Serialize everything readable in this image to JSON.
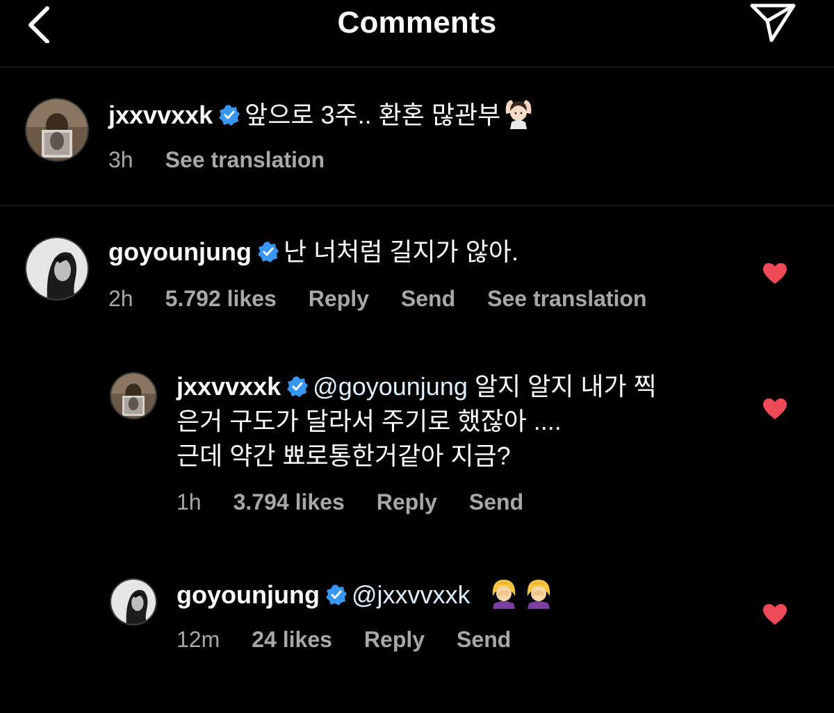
{
  "header": {
    "title": "Comments",
    "back_icon": "chevron-left-icon",
    "send_icon": "paper-plane-icon"
  },
  "colors": {
    "background": "#000000",
    "text": "#ffffff",
    "meta_text": "#a8a8a8",
    "verified": "#3897f0",
    "heart": "#ed4956",
    "mention": "#e0f1ff"
  },
  "caption": {
    "username": "jxxvvxxk",
    "text": "앞으로 3주.. 환혼 많관부",
    "time": "3h",
    "see_translation": "See translation"
  },
  "comments": [
    {
      "username": "goyounjung",
      "text": "난 너처럼 길지가 않아.",
      "time": "2h",
      "likes": "5.792 likes",
      "reply": "Reply",
      "send": "Send",
      "see_translation": "See translation",
      "liked": true
    },
    {
      "username": "jxxvvxxk",
      "mention": "@goyounjung",
      "text_line1": "알지 알지 내가 찍",
      "text_line2": "은거 구도가 달라서 주기로 했잖아 ....",
      "text_line3": "근데 약간 뾰로통한거같아 지금?",
      "time": "1h",
      "likes": "3.794 likes",
      "reply": "Reply",
      "send": "Send",
      "liked": true
    },
    {
      "username": "goyounjung",
      "mention": "@jxxvvxxk",
      "time": "12m",
      "likes": "24 likes",
      "reply": "Reply",
      "send": "Send",
      "liked": true
    }
  ]
}
